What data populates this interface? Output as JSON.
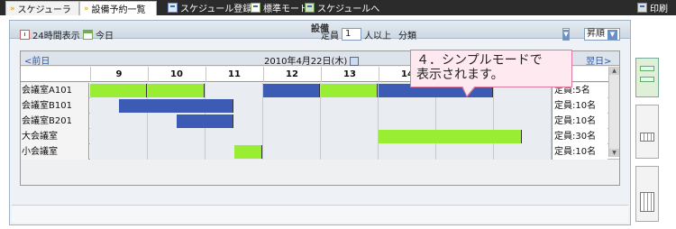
{
  "tabs": [
    {
      "label": "スケジューラ"
    },
    {
      "label": "設備予約一覧"
    }
  ],
  "toolbar": {
    "schedule_register": "スケジュール登録",
    "standard_mode": "標準モード",
    "to_schedule": "スケジュールへ",
    "print": "印刷"
  },
  "panel": {
    "title": "設備"
  },
  "controls": {
    "display_24h": "24時間表示",
    "today": "今日",
    "capacity_label": "定員",
    "capacity_value": "1",
    "capacity_suffix": "人以上",
    "category_label": "分類",
    "sort_order": "昇順"
  },
  "nav": {
    "prev": "<前日",
    "date": "2010年4月22日(木)",
    "next": "翌日>"
  },
  "hours": [
    "9",
    "10",
    "11",
    "12",
    "13",
    "14",
    "15",
    "16"
  ],
  "rooms": [
    {
      "name": "会議室A101",
      "capacity": "定員:5名"
    },
    {
      "name": "会議室B101",
      "capacity": "定員:10名"
    },
    {
      "name": "会議室B201",
      "capacity": "定員:10名"
    },
    {
      "name": "大会議室",
      "capacity": "定員:30名"
    },
    {
      "name": "小会議室",
      "capacity": "定員:10名"
    }
  ],
  "reservations": [
    {
      "room": 0,
      "start": 9.0,
      "end": 10.0,
      "color": "#99ee33"
    },
    {
      "room": 0,
      "start": 10.0,
      "end": 11.0,
      "color": "#99ee33"
    },
    {
      "room": 0,
      "start": 12.0,
      "end": 13.0,
      "color": "#3b5bb5"
    },
    {
      "room": 0,
      "start": 13.0,
      "end": 14.0,
      "color": "#99ee33"
    },
    {
      "room": 0,
      "start": 14.0,
      "end": 16.0,
      "color": "#3b5bb5"
    },
    {
      "room": 1,
      "start": 9.5,
      "end": 11.5,
      "color": "#3b5bb5"
    },
    {
      "room": 2,
      "start": 10.5,
      "end": 11.5,
      "color": "#3b5bb5"
    },
    {
      "room": 3,
      "start": 14.0,
      "end": 16.5,
      "color": "#99ee33"
    },
    {
      "room": 4,
      "start": 11.5,
      "end": 12.0,
      "color": "#99ee33"
    }
  ],
  "tooltip": {
    "line1": "４．シンプルモードで",
    "line2": "表示されます。"
  }
}
